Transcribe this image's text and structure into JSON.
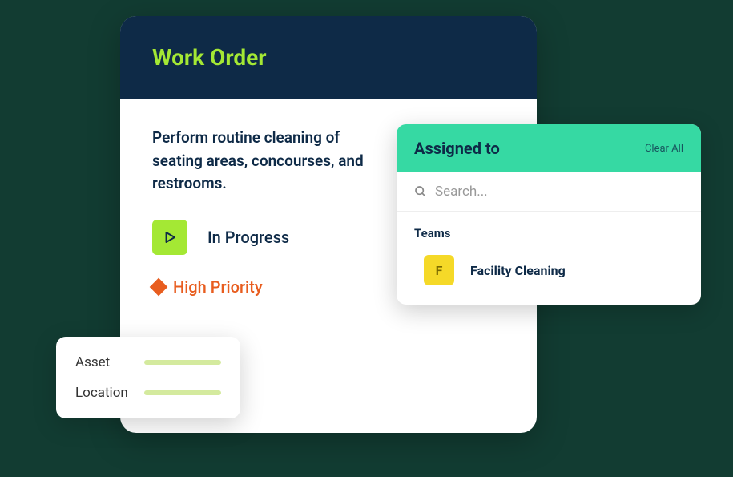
{
  "workOrder": {
    "title": "Work Order",
    "description": "Perform routine cleaning of seating areas, concourses, and restrooms.",
    "status": "In Progress",
    "priority": "High Priority"
  },
  "assigned": {
    "title": "Assigned to",
    "clearAll": "Clear All",
    "searchPlaceholder": "Search...",
    "teamsLabel": "Teams",
    "teams": [
      {
        "initial": "F",
        "name": "Facility Cleaning"
      }
    ]
  },
  "meta": {
    "assetLabel": "Asset",
    "locationLabel": "Location"
  }
}
